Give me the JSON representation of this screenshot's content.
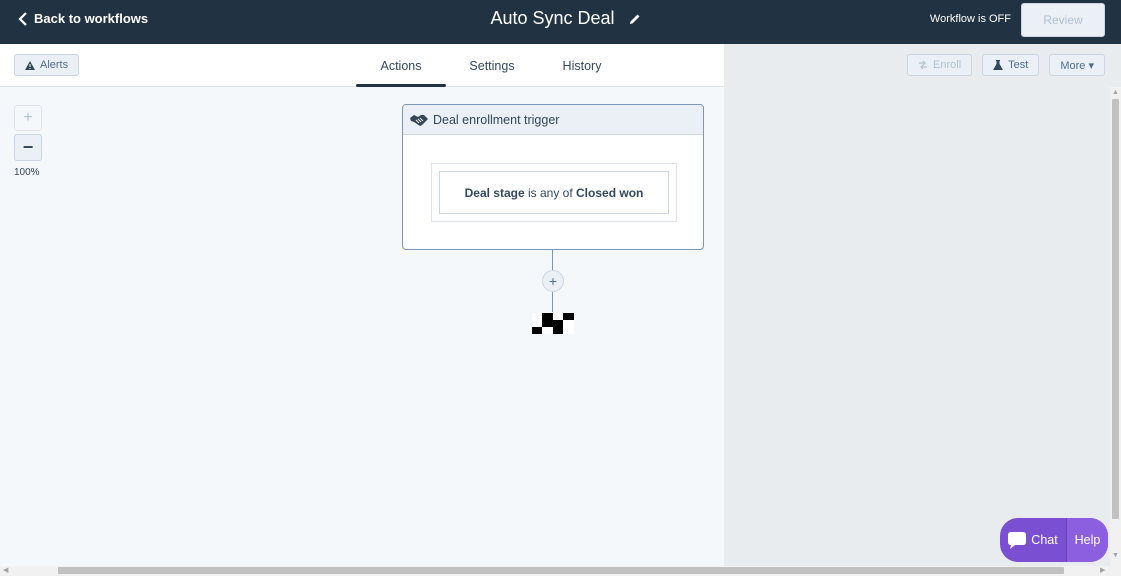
{
  "header": {
    "back_label": "Back to workflows",
    "title": "Auto Sync Deal",
    "status": "Workflow is OFF",
    "review_label": "Review"
  },
  "toolbar": {
    "alerts_label": "Alerts",
    "tabs": [
      {
        "label": "Actions",
        "active": true
      },
      {
        "label": "Settings",
        "active": false
      },
      {
        "label": "History",
        "active": false
      }
    ],
    "enroll_label": "Enroll",
    "test_label": "Test",
    "more_label": "More ▾"
  },
  "canvas": {
    "zoom_in": "+",
    "zoom_out": "−",
    "zoom_level": "100%",
    "trigger": {
      "title": "Deal enrollment trigger",
      "condition_property": "Deal stage",
      "condition_operator": " is any of ",
      "condition_value": "Closed won"
    },
    "add_action": "+"
  },
  "widget": {
    "chat_label": "Chat",
    "help_label": "Help"
  },
  "colors": {
    "header_bg": "#213343",
    "accent": "#7b4fd1",
    "border": "#cbd6e2"
  },
  "icons": {
    "back": "chevron-left-icon",
    "edit": "pencil-icon",
    "alert": "warning-icon",
    "enroll": "enroll-icon",
    "test": "flask-icon",
    "trigger": "handshake-icon",
    "finish": "checkered-flag-icon",
    "chat": "chat-bubble-icon"
  }
}
